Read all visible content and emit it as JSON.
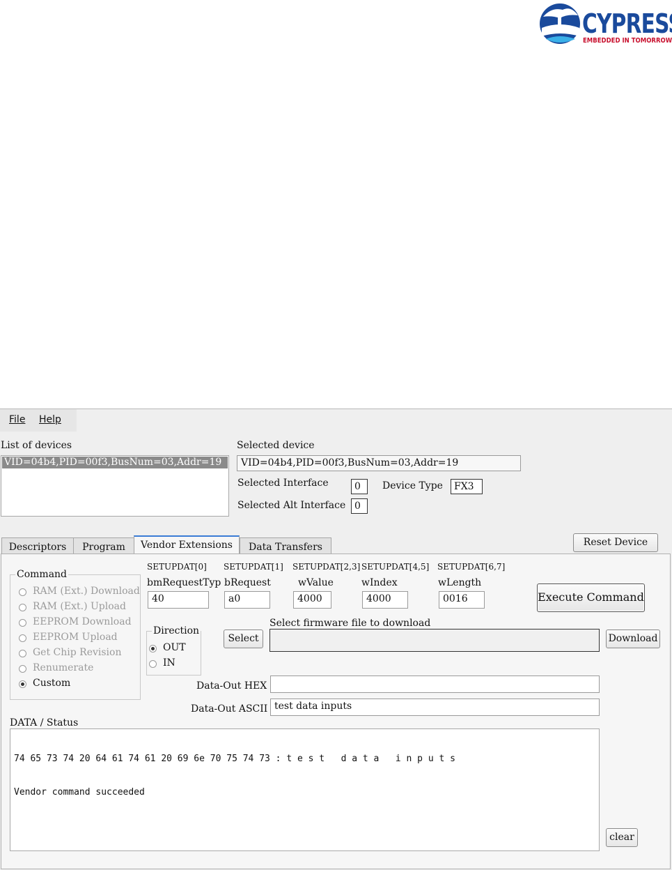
{
  "logo": {
    "brand": "CYPRESS",
    "tagline": "EMBEDDED IN TOMORROW™"
  },
  "menu": {
    "file": "File",
    "help": "Help"
  },
  "devices": {
    "list_label": "List of devices",
    "items": [
      "VID=04b4,PID=00f3,BusNum=03,Addr=19"
    ],
    "selected_label": "Selected device",
    "selected_value": "VID=04b4,PID=00f3,BusNum=03,Addr=19",
    "interface_label": "Selected Interface",
    "interface_value": "0",
    "alt_interface_label": "Selected Alt Interface",
    "alt_interface_value": "0",
    "device_type_label": "Device Type",
    "device_type_value": "FX3"
  },
  "tabs": [
    {
      "label": "Descriptors",
      "active": false
    },
    {
      "label": "Program",
      "active": false
    },
    {
      "label": "Vendor Extensions",
      "active": true
    },
    {
      "label": "Data Transfers",
      "active": false
    }
  ],
  "reset_button": "Reset Device",
  "command": {
    "title": "Command",
    "options": [
      {
        "label": "RAM (Ext.) Download",
        "enabled": false,
        "selected": false
      },
      {
        "label": "RAM (Ext.) Upload",
        "enabled": false,
        "selected": false
      },
      {
        "label": "EEPROM Download",
        "enabled": false,
        "selected": false
      },
      {
        "label": "EEPROM Upload",
        "enabled": false,
        "selected": false
      },
      {
        "label": "Get Chip Revision",
        "enabled": false,
        "selected": false
      },
      {
        "label": "Renumerate",
        "enabled": false,
        "selected": false
      },
      {
        "label": "Custom",
        "enabled": true,
        "selected": true
      }
    ]
  },
  "setup": {
    "fields": [
      {
        "header": "SETUPDAT[0]",
        "name": "bmRequestTyp",
        "value": "40"
      },
      {
        "header": "SETUPDAT[1]",
        "name": "bRequest",
        "value": "a0"
      },
      {
        "header": "SETUPDAT[2,3]",
        "name": "wValue",
        "value": "4000"
      },
      {
        "header": "SETUPDAT[4,5]",
        "name": "wIndex",
        "value": "4000"
      },
      {
        "header": "SETUPDAT[6,7]",
        "name": "wLength",
        "value": "0016"
      }
    ]
  },
  "execute_button": "Execute Command",
  "direction": {
    "title": "Direction",
    "out": "OUT",
    "in": "IN",
    "selected": "OUT"
  },
  "firmware": {
    "label": "Select firmware file to download",
    "select_button": "Select",
    "path": "",
    "download_button": "Download"
  },
  "data_out": {
    "hex_label": "Data-Out HEX",
    "hex_value": "",
    "ascii_label": "Data-Out ASCII",
    "ascii_value": "test data inputs"
  },
  "status": {
    "label": "DATA / Status",
    "lines": [
      "74 65 73 74 20 64 61 74 61 20 69 6e 70 75 74 73 : t e s t   d a t a   i n p u t s",
      "Vendor command succeeded"
    ]
  },
  "clear_button": "clear",
  "colors": {
    "brand_blue": "#1a4a9c",
    "brand_red": "#c8102e",
    "selection": "#8a8a8a",
    "tab_accent": "#3a7bd5"
  }
}
